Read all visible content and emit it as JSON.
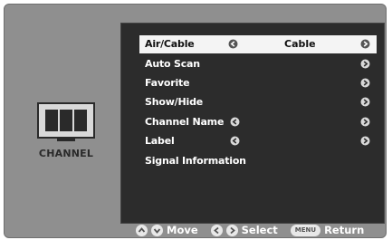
{
  "sidebar": {
    "label": "CHANNEL",
    "icon": "tv-icon"
  },
  "menu": {
    "items": [
      {
        "label": "Air/Cable",
        "value": "Cable",
        "selected": true
      },
      {
        "label": "Auto Scan"
      },
      {
        "label": "Favorite"
      },
      {
        "label": "Show/Hide"
      },
      {
        "label": "Channel Name"
      },
      {
        "label": "Label"
      },
      {
        "label": "Signal Information"
      }
    ]
  },
  "footer": {
    "move_label": "Move",
    "select_label": "Select",
    "menu_key": "MENU",
    "return_label": "Return"
  },
  "colors": {
    "frame": "#8f8f8f",
    "menu_bg": "#2c2c2c",
    "highlight": "#f4f4f4"
  }
}
